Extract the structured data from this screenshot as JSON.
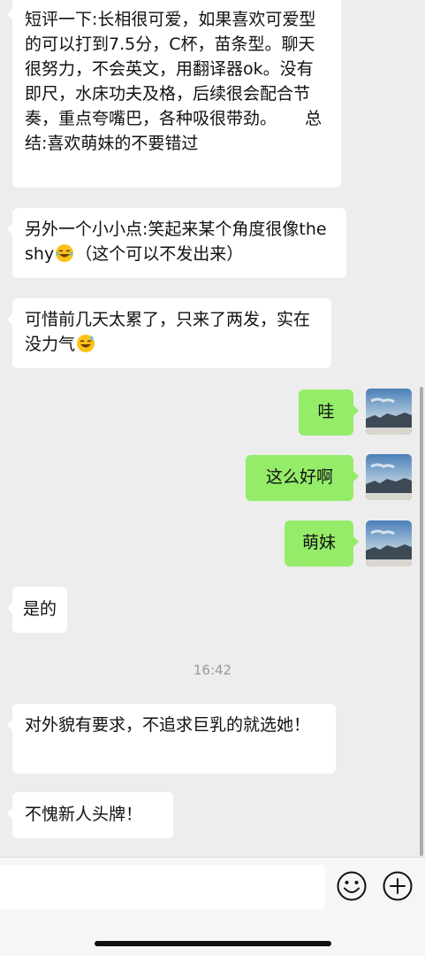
{
  "messages": {
    "m1": "短评一下:长相很可爱，如果喜欢可爱型的可以打到7.5分，C杯，苗条型。聊天很努力，不会英文，用翻译器ok。没有即尺，水床功夫及格，后续很会配合节奏，重点夸嘴巴，各种吸很带劲。",
    "m1_tail": "总结:喜欢萌妹的不要错过",
    "m2_a": "另外一个小小点:笑起来某个角度很像the shy",
    "m2_b": "（这个可以不发出来）",
    "m3_a": "可惜前几天太累了，只来了两发，实在没力气",
    "m4": "哇",
    "m5": "这么好啊",
    "m6": "萌妹",
    "m7": "是的",
    "m8": "对外貌有要求，不追求巨乳的就选她！",
    "m9": "不愧新人头牌！"
  },
  "timestamp": "16:42",
  "input": {
    "placeholder": ""
  },
  "icons": {
    "emoji_button": "smiley-icon",
    "more_button": "plus-icon",
    "emoji_in_text": "tears-of-joy-emoji"
  },
  "colors": {
    "background": "#ededed",
    "incoming_bubble": "#ffffff",
    "outgoing_bubble": "#95ec69",
    "timestamp": "#9a9a9a"
  }
}
